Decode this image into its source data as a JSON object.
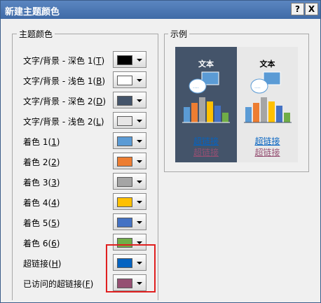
{
  "window": {
    "title": "新建主题颜色"
  },
  "titlebar": {
    "help_label": "?",
    "close_label": "X"
  },
  "theme_group": {
    "label": "主题颜色"
  },
  "rows": [
    {
      "label": "文字/背景 - 深色 1(",
      "key": "T",
      "end": ")",
      "color": "#000000"
    },
    {
      "label": "文字/背景 - 浅色 1(",
      "key": "B",
      "end": ")",
      "color": "#ffffff"
    },
    {
      "label": "文字/背景 - 深色 2(",
      "key": "D",
      "end": ")",
      "color": "#44546a"
    },
    {
      "label": "文字/背景 - 浅色 2(",
      "key": "L",
      "end": ")",
      "color": "#e7e6e6"
    },
    {
      "label": "着色 1(",
      "key": "1",
      "end": ")",
      "color": "#5b9bd5"
    },
    {
      "label": "着色 2(",
      "key": "2",
      "end": ")",
      "color": "#ed7d31"
    },
    {
      "label": "着色 3(",
      "key": "3",
      "end": ")",
      "color": "#a5a5a5"
    },
    {
      "label": "着色 4(",
      "key": "4",
      "end": ")",
      "color": "#ffc000"
    },
    {
      "label": "着色 5(",
      "key": "5",
      "end": ")",
      "color": "#4472c4"
    },
    {
      "label": "着色 6(",
      "key": "6",
      "end": ")",
      "color": "#70ad47"
    },
    {
      "label": "超链接(",
      "key": "H",
      "end": ")",
      "color": "#0563c1"
    },
    {
      "label": "已访问的超链接(",
      "key": "F",
      "end": ")",
      "color": "#954f72"
    }
  ],
  "sample": {
    "label": "示例",
    "text": "文本",
    "hyperlink": "超链接",
    "visited": "超链接",
    "dark_bg": "#44546a",
    "light_bg": "#e8e8e8",
    "bar_colors": [
      "#5b9bd5",
      "#ed7d31",
      "#a5a5a5",
      "#ffc000",
      "#4472c4",
      "#70ad47"
    ]
  }
}
